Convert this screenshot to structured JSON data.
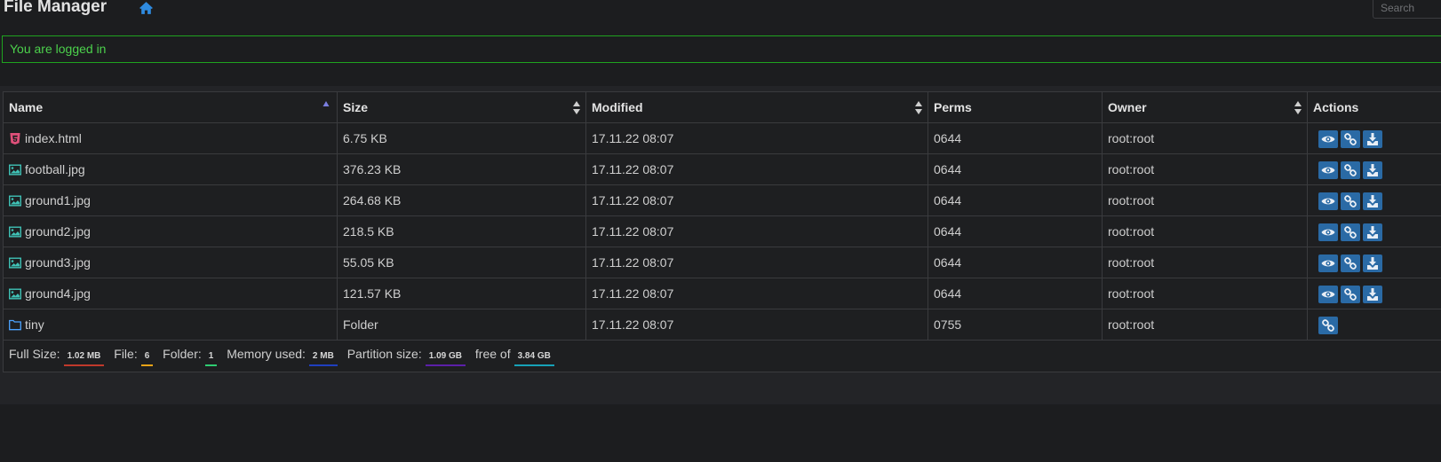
{
  "app": {
    "title": "File Manager"
  },
  "search": {
    "placeholder": "Search"
  },
  "alert": {
    "message": "You are logged in"
  },
  "table": {
    "headers": {
      "name": "Name",
      "size": "Size",
      "modified": "Modified",
      "perms": "Perms",
      "owner": "Owner",
      "actions": "Actions"
    },
    "rows": [
      {
        "icon": "html5-icon",
        "name": "index.html",
        "size": "6.75 KB",
        "modified": "17.11.22 08:07",
        "perms": "0644",
        "owner": "root:root"
      },
      {
        "icon": "image-icon",
        "name": "football.jpg",
        "size": "376.23 KB",
        "modified": "17.11.22 08:07",
        "perms": "0644",
        "owner": "root:root"
      },
      {
        "icon": "image-icon",
        "name": "ground1.jpg",
        "size": "264.68 KB",
        "modified": "17.11.22 08:07",
        "perms": "0644",
        "owner": "root:root"
      },
      {
        "icon": "image-icon",
        "name": "ground2.jpg",
        "size": "218.5 KB",
        "modified": "17.11.22 08:07",
        "perms": "0644",
        "owner": "root:root"
      },
      {
        "icon": "image-icon",
        "name": "ground3.jpg",
        "size": "55.05 KB",
        "modified": "17.11.22 08:07",
        "perms": "0644",
        "owner": "root:root"
      },
      {
        "icon": "image-icon",
        "name": "ground4.jpg",
        "size": "121.57 KB",
        "modified": "17.11.22 08:07",
        "perms": "0644",
        "owner": "root:root"
      },
      {
        "icon": "folder-icon",
        "name": "tiny",
        "size": "Folder",
        "modified": "17.11.22 08:07",
        "perms": "0755",
        "owner": "root:root"
      }
    ]
  },
  "footer": {
    "full_size_label": "Full Size:",
    "full_size": "1.02 MB",
    "file_label": "File:",
    "file_count": "6",
    "folder_label": "Folder:",
    "folder_count": "1",
    "memory_label": "Memory used:",
    "memory": "2 MB",
    "partition_label": "Partition size:",
    "partition": "1.09 GB",
    "free_label": "free of",
    "free": "3.84 GB"
  },
  "colors": {
    "accent": "#2a6aa5",
    "alert_border": "#1fa31f",
    "alert_text": "#4cd14c",
    "badge_full_size": "#c0392b",
    "badge_file": "#e8a317",
    "badge_folder": "#2ecc71",
    "badge_memory": "#1f3fbf",
    "badge_partition": "#5b1fa8",
    "badge_free": "#17a2b8"
  }
}
